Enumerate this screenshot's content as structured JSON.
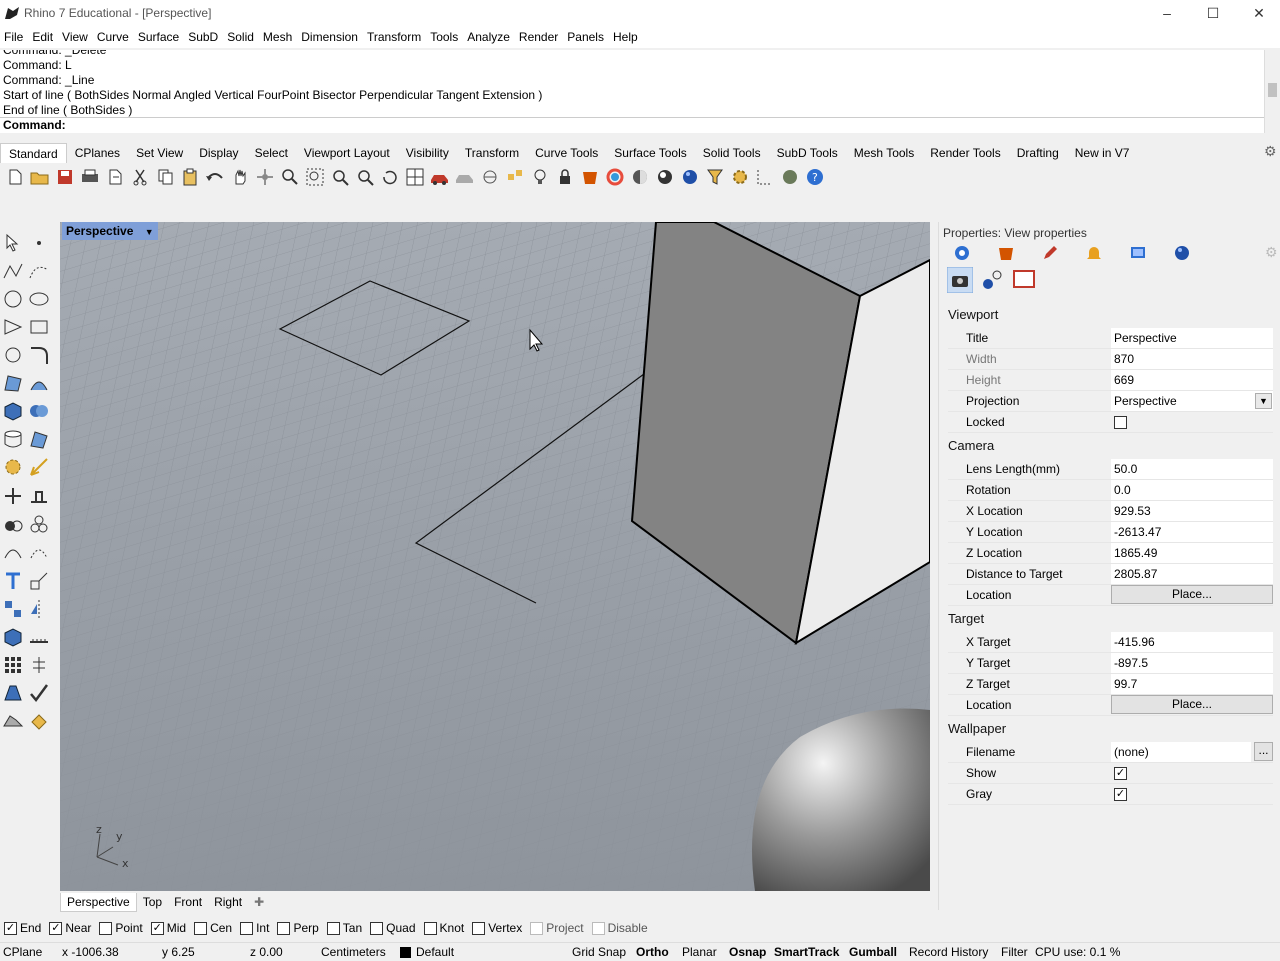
{
  "window": {
    "title": "Rhino 7 Educational - [Perspective]"
  },
  "menu": [
    "File",
    "Edit",
    "View",
    "Curve",
    "Surface",
    "SubD",
    "Solid",
    "Mesh",
    "Dimension",
    "Transform",
    "Tools",
    "Analyze",
    "Render",
    "Panels",
    "Help"
  ],
  "command_history": [
    "Command: _Delete",
    "Command: L",
    "Command: _Line",
    "Start of line ( BothSides  Normal  Angled  Vertical  FourPoint  Bisector  Perpendicular  Tangent  Extension )",
    "End of line ( BothSides )"
  ],
  "command_prompt": "Command:",
  "toolbar_tabs": [
    "Standard",
    "CPlanes",
    "Set View",
    "Display",
    "Select",
    "Viewport Layout",
    "Visibility",
    "Transform",
    "Curve Tools",
    "Surface Tools",
    "Solid Tools",
    "SubD Tools",
    "Mesh Tools",
    "Render Tools",
    "Drafting",
    "New in V7"
  ],
  "viewport": {
    "label": "Perspective",
    "tabs": [
      "Perspective",
      "Top",
      "Front",
      "Right"
    ]
  },
  "properties": {
    "panel_title": "Properties: View properties",
    "viewport_section": "Viewport",
    "title_label": "Title",
    "title_value": "Perspective",
    "width_label": "Width",
    "width_value": "870",
    "height_label": "Height",
    "height_value": "669",
    "projection_label": "Projection",
    "projection_value": "Perspective",
    "locked_label": "Locked",
    "locked": false,
    "camera_section": "Camera",
    "lens_label": "Lens Length(mm)",
    "lens_value": "50.0",
    "rotation_label": "Rotation",
    "rotation_value": "0.0",
    "xloc_label": "X Location",
    "xloc_value": "929.53",
    "yloc_label": "Y Location",
    "yloc_value": "-2613.47",
    "zloc_label": "Z Location",
    "zloc_value": "1865.49",
    "dist_label": "Distance to Target",
    "dist_value": "2805.87",
    "location_label": "Location",
    "place_label": "Place...",
    "target_section": "Target",
    "xt_label": "X Target",
    "xt_value": "-415.96",
    "yt_label": "Y Target",
    "yt_value": "-897.5",
    "zt_label": "Z Target",
    "zt_value": "99.7",
    "wallpaper_section": "Wallpaper",
    "filename_label": "Filename",
    "filename_value": "(none)",
    "browse_label": "...",
    "show_label": "Show",
    "show": true,
    "gray_label": "Gray",
    "gray": true
  },
  "osnaps": [
    {
      "label": "End",
      "checked": true
    },
    {
      "label": "Near",
      "checked": true
    },
    {
      "label": "Point",
      "checked": false
    },
    {
      "label": "Mid",
      "checked": true
    },
    {
      "label": "Cen",
      "checked": false
    },
    {
      "label": "Int",
      "checked": false
    },
    {
      "label": "Perp",
      "checked": false
    },
    {
      "label": "Tan",
      "checked": false
    },
    {
      "label": "Quad",
      "checked": false
    },
    {
      "label": "Knot",
      "checked": false
    },
    {
      "label": "Vertex",
      "checked": false
    },
    {
      "label": "Project",
      "checked": false,
      "dim": true
    },
    {
      "label": "Disable",
      "checked": false,
      "dim": true
    }
  ],
  "status": {
    "cplane": "CPlane",
    "x": "x -1006.38",
    "y": "y 6.25",
    "z": "z 0.00",
    "units": "Centimeters",
    "layer": "Default",
    "grid_snap": "Grid Snap",
    "ortho": "Ortho",
    "planar": "Planar",
    "osnap": "Osnap",
    "smarttrack": "SmartTrack",
    "gumball": "Gumball",
    "record_history": "Record History",
    "filter": "Filter",
    "cpu": "CPU use: 0.1 %"
  },
  "colors": {
    "viewport_bg": "#9aa0a8",
    "label_active": "#7f9fd8"
  }
}
